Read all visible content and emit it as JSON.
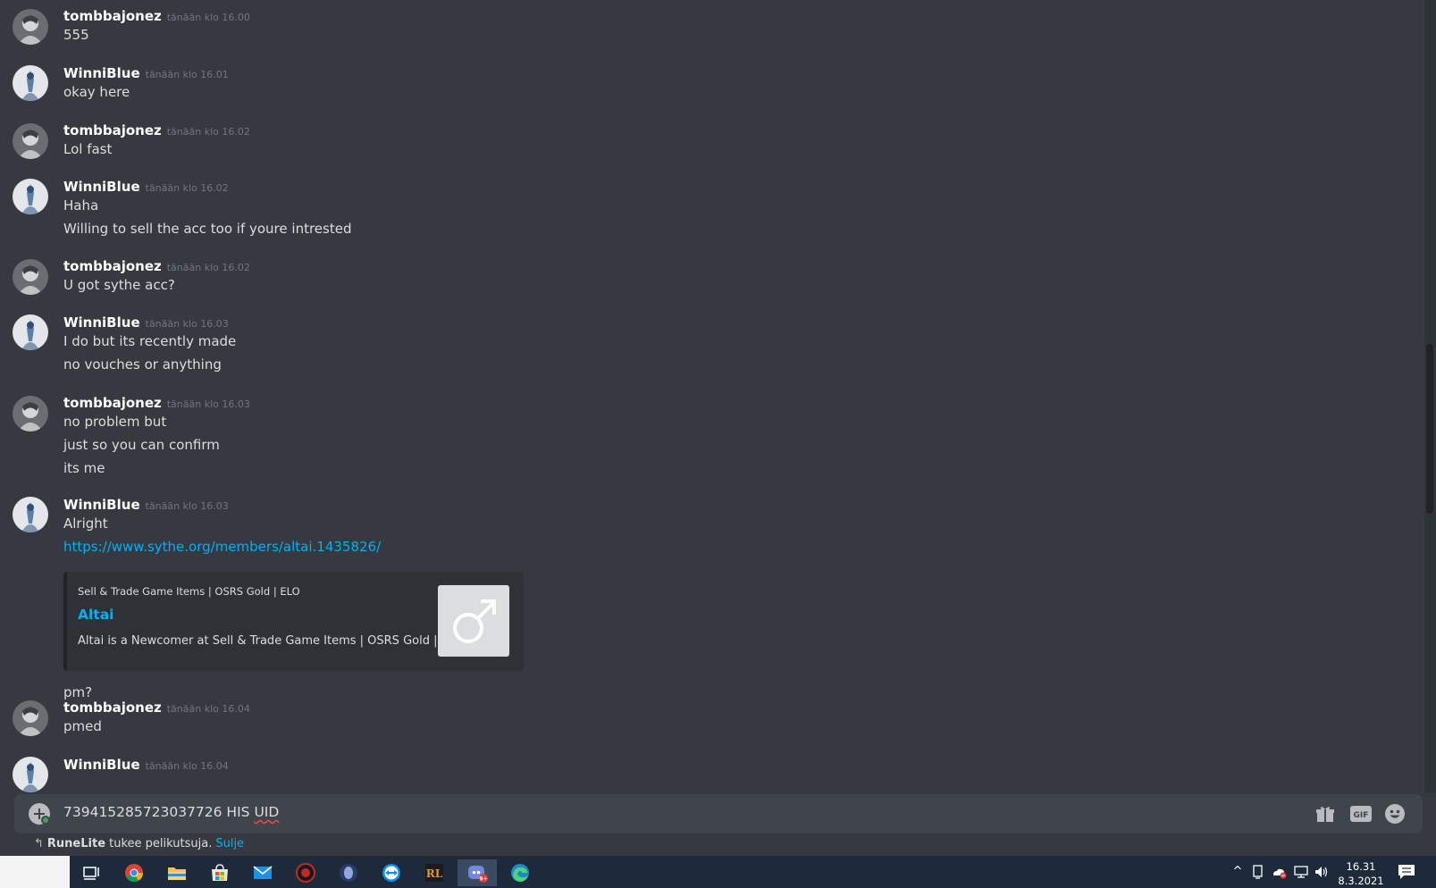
{
  "messages": [
    {
      "username": "tombbajonez",
      "timestamp": "tänään klo 16.00",
      "avatar": "tombbajonez",
      "lines": [
        "555"
      ]
    },
    {
      "username": "WinniBlue",
      "timestamp": "tänään klo 16.01",
      "avatar": "winniblue",
      "lines": [
        "okay here"
      ]
    },
    {
      "username": "tombbajonez",
      "timestamp": "tänään klo 16.02",
      "avatar": "tombbajonez",
      "lines": [
        "Lol fast"
      ]
    },
    {
      "username": "WinniBlue",
      "timestamp": "tänään klo 16.02",
      "avatar": "winniblue",
      "lines": [
        "Haha",
        "Willing to sell the acc too if youre intrested"
      ]
    },
    {
      "username": "tombbajonez",
      "timestamp": "tänään klo 16.02",
      "avatar": "tombbajonez",
      "lines": [
        "U got sythe acc?"
      ]
    },
    {
      "username": "WinniBlue",
      "timestamp": "tänään klo 16.03",
      "avatar": "winniblue",
      "lines": [
        "I do but its recently made",
        "no vouches or anything"
      ]
    },
    {
      "username": "tombbajonez",
      "timestamp": "tänään klo 16.03",
      "avatar": "tombbajonez",
      "lines": [
        "no problem but",
        "just so you can confirm",
        "its me"
      ]
    },
    {
      "username": "WinniBlue",
      "timestamp": "tänään klo 16.03",
      "avatar": "winniblue",
      "lines": [
        "Alright"
      ],
      "link": "https://www.sythe.org/members/altai.1435826/",
      "after_embed": "pm?"
    },
    {
      "username": "tombbajonez",
      "timestamp": "tänään klo 16.04",
      "avatar": "tombbajonez",
      "lines": [
        "pmed"
      ]
    },
    {
      "username": "WinniBlue",
      "timestamp": "tänään klo 16.04",
      "avatar": "winniblue",
      "lines": []
    }
  ],
  "embed": {
    "provider": "Sell & Trade Game Items | OSRS Gold | ELO",
    "title": "Altai",
    "description": "Altai is a Newcomer at Sell & Trade Game Items | OSRS Gold | ELO",
    "thumbnail_icon": "male-symbol-icon"
  },
  "composer": {
    "text_main": "739415285723037726 HIS ",
    "text_misspelled": "UID",
    "buttons": [
      "gift-icon",
      "gif-button",
      "emoji-icon"
    ],
    "gif_label": "GIF"
  },
  "notice": {
    "app_name": "RuneLite",
    "text": " tukee pelikutsuja.",
    "close_label": "Sulje"
  },
  "taskbar": {
    "apps": [
      "task-view-icon",
      "chrome-icon",
      "file-explorer-icon",
      "store-icon",
      "mail-icon",
      "app-red-icon",
      "app-blue-icon",
      "teamviewer-icon",
      "runelite-icon",
      "discord-icon",
      "edge-icon"
    ],
    "discord_badge": "9+",
    "clock_time": "16.31",
    "clock_date": "8.3.2021"
  },
  "colors": {
    "background": "#36393f",
    "link": "#00aff4",
    "username": "#ffffff",
    "timestamp": "#72767d",
    "text": "#dcddde"
  }
}
